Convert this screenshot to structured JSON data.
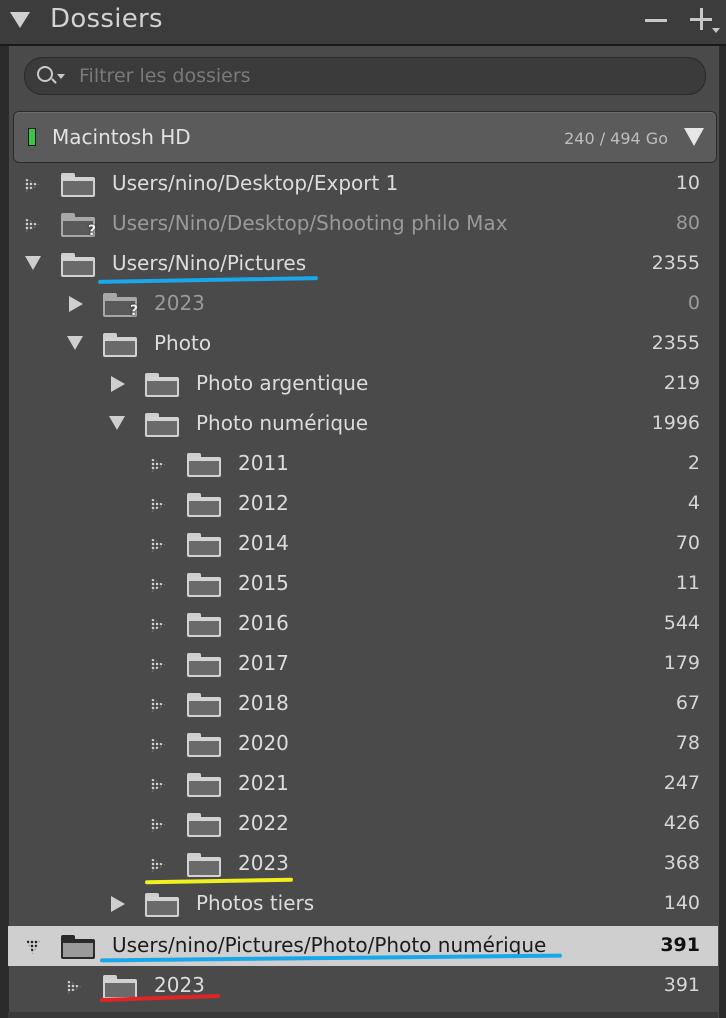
{
  "panel": {
    "title": "Dossiers",
    "minus_label": "−",
    "plus_label": "+"
  },
  "search": {
    "placeholder": "Filtrer les dossiers",
    "value": ""
  },
  "volume": {
    "name": "Macintosh HD",
    "size": "240 / 494 Go",
    "status_color": "#3ec24a"
  },
  "folders": [
    {
      "label": "Users/nino/Desktop/Export 1",
      "count": "10"
    },
    {
      "label": "Users/Nino/Desktop/Shooting philo Max",
      "count": "80"
    },
    {
      "label": "Users/Nino/Pictures",
      "count": "2355"
    },
    {
      "label": "2023",
      "count": "0"
    },
    {
      "label": "Photo",
      "count": "2355"
    },
    {
      "label": "Photo argentique",
      "count": "219"
    },
    {
      "label": "Photo numérique",
      "count": "1996"
    },
    {
      "label": "2011",
      "count": "2"
    },
    {
      "label": "2012",
      "count": "4"
    },
    {
      "label": "2014",
      "count": "70"
    },
    {
      "label": "2015",
      "count": "11"
    },
    {
      "label": "2016",
      "count": "544"
    },
    {
      "label": "2017",
      "count": "179"
    },
    {
      "label": "2018",
      "count": "67"
    },
    {
      "label": "2020",
      "count": "78"
    },
    {
      "label": "2021",
      "count": "247"
    },
    {
      "label": "2022",
      "count": "426"
    },
    {
      "label": "2023",
      "count": "368"
    },
    {
      "label": "Photos tiers",
      "count": "140"
    },
    {
      "label": "Users/nino/Pictures/Photo/Photo numérique",
      "count": "391"
    },
    {
      "label": "2023",
      "count": "391"
    }
  ],
  "annotation_colors": {
    "blue": "#18a7e8",
    "yellow": "#f0f020",
    "red": "#e02424"
  }
}
